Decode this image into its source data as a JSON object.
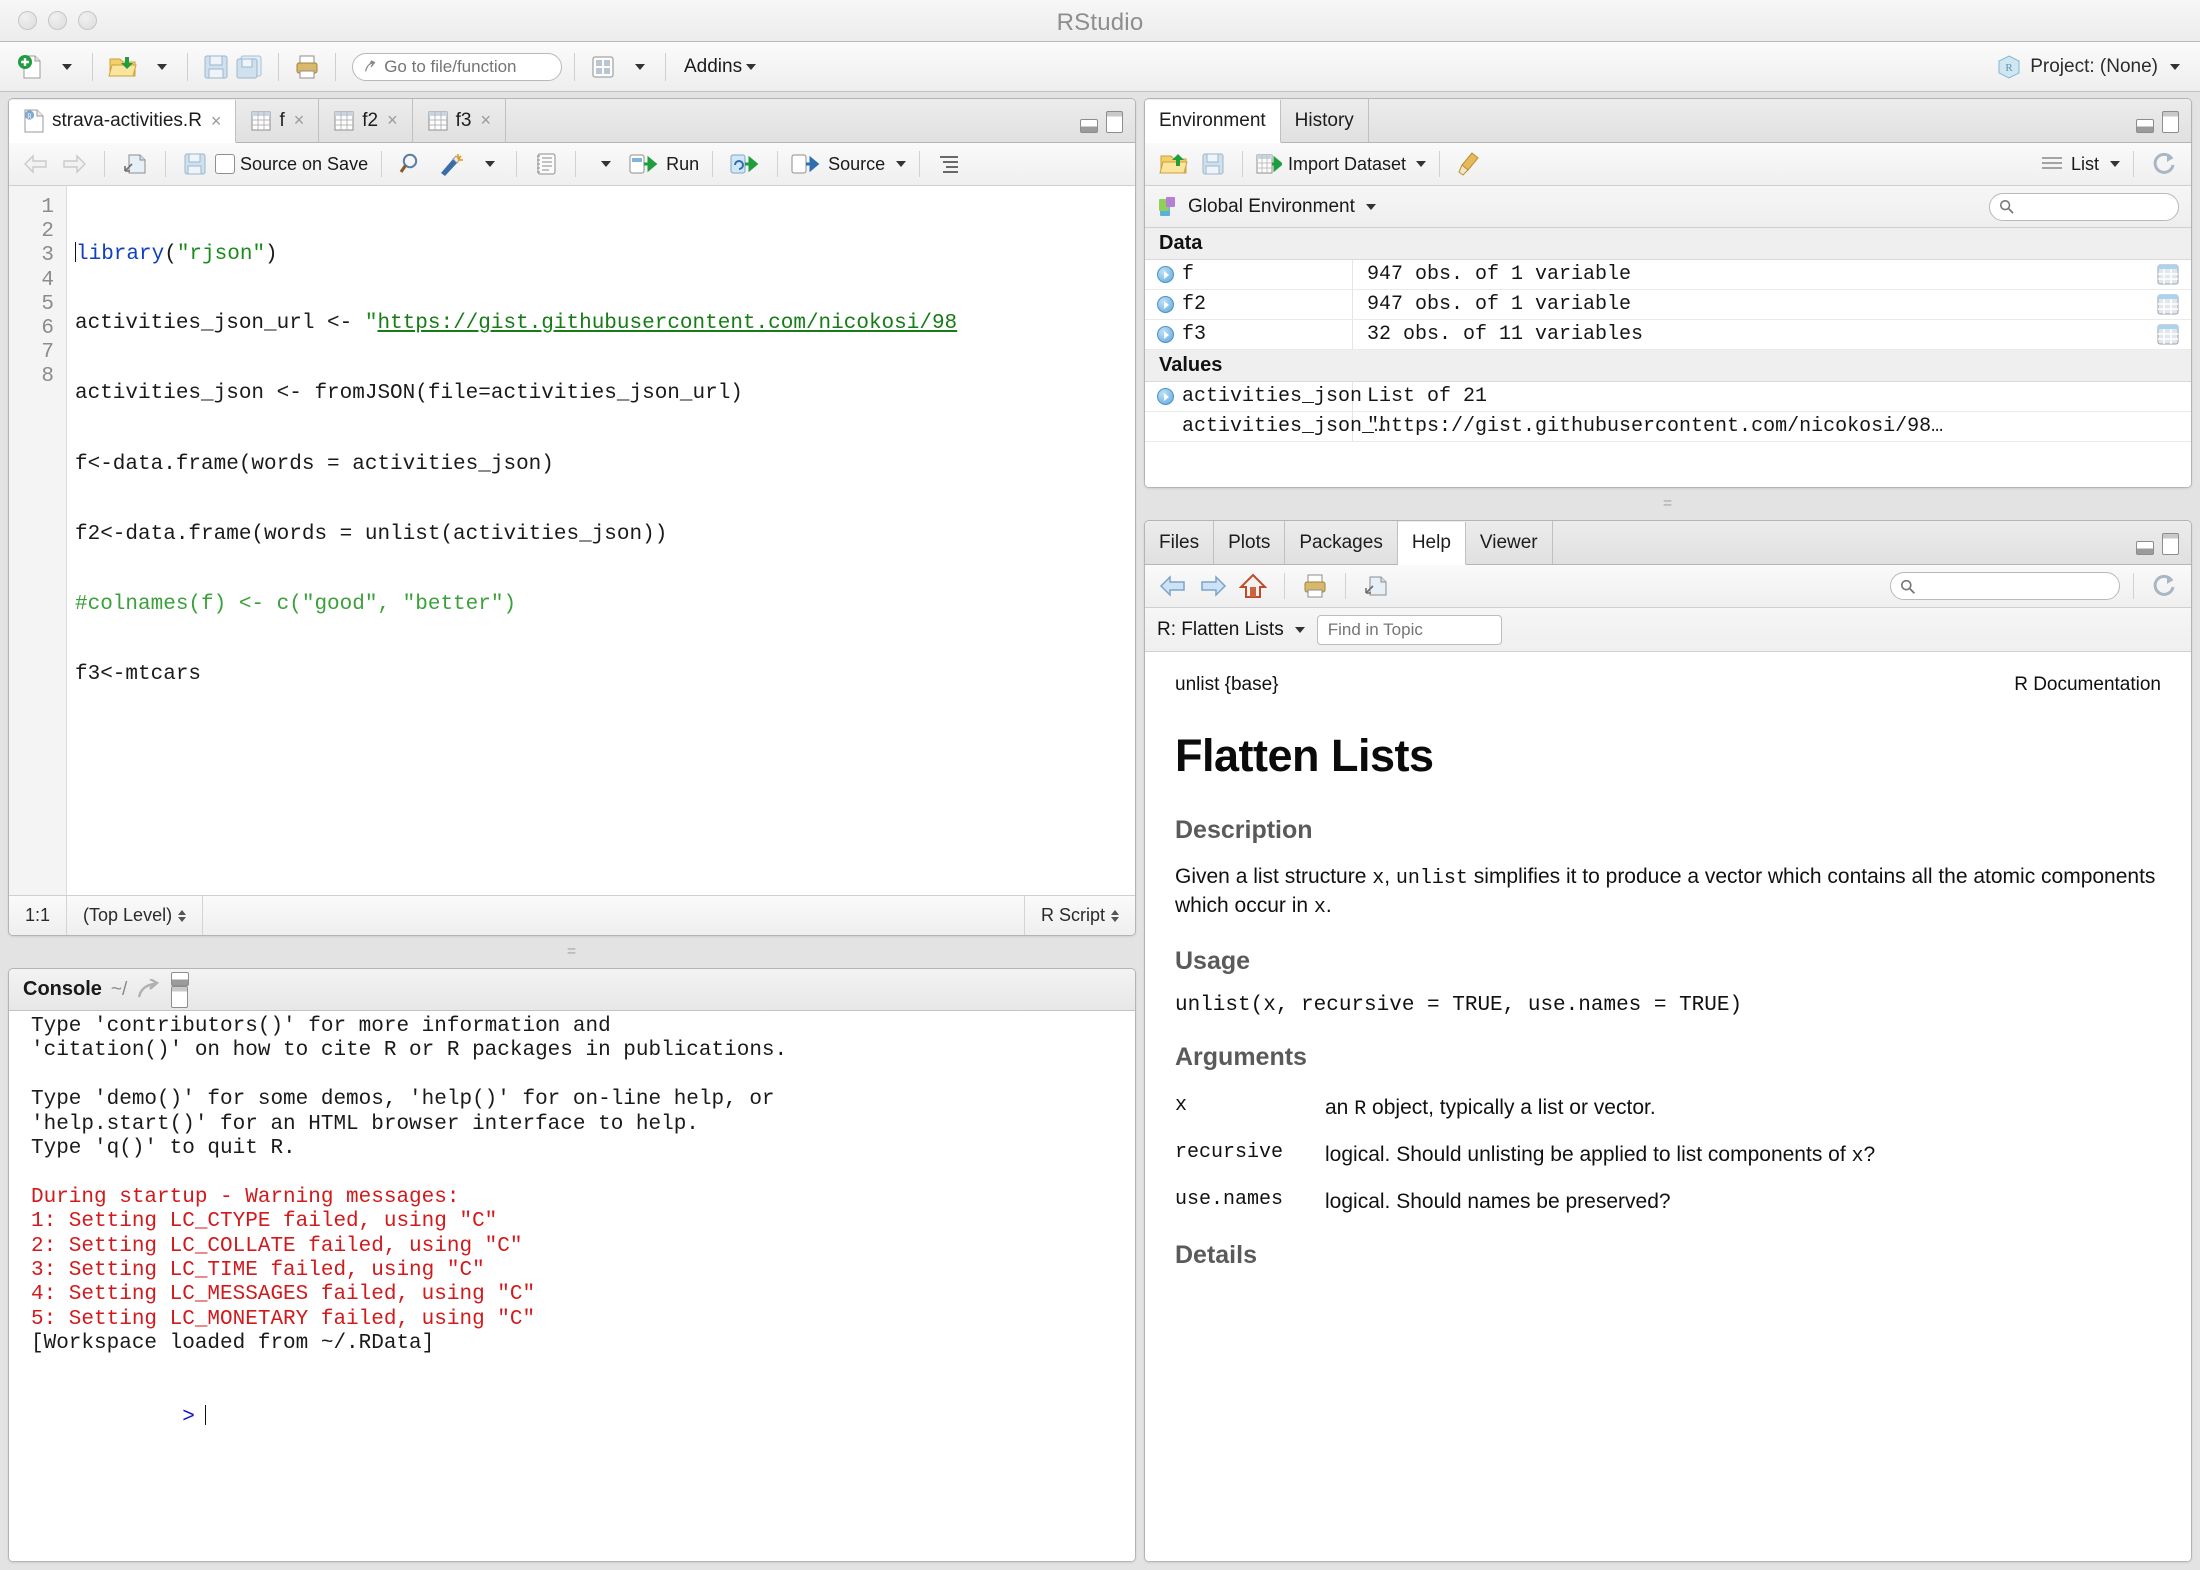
{
  "window": {
    "title": "RStudio"
  },
  "toolbar": {
    "new_file": "new-file",
    "open_file": "open-file",
    "save": "save",
    "save_all": "save-all",
    "print": "print",
    "goto_placeholder": "Go to file/function",
    "goto_value": "",
    "workspace_panes": "workspace-panes",
    "addins_label": "Addins",
    "project_label": "Project: (None)"
  },
  "editor": {
    "tabs": [
      {
        "label": "strava-activities.R",
        "icon": "r-script-icon",
        "active": true
      },
      {
        "label": "f",
        "icon": "data-frame-icon",
        "active": false
      },
      {
        "label": "f2",
        "icon": "data-frame-icon",
        "active": false
      },
      {
        "label": "f3",
        "icon": "data-frame-icon",
        "active": false
      }
    ],
    "toolbar": {
      "back": "back",
      "forward": "forward",
      "popout": "show-in-new-window",
      "save": "save",
      "source_on_save": "Source on Save",
      "find": "find-replace",
      "compile_report": "compile-report",
      "code_tools": "code-tools",
      "run": "Run",
      "rerun": "re-run-previous",
      "source": "Source",
      "outline": "document-outline"
    },
    "lines": [
      {
        "n": "1",
        "segments": [
          {
            "t": "library",
            "c": "k-fn"
          },
          {
            "t": "(",
            "c": ""
          },
          {
            "t": "\"rjson\"",
            "c": "k-str"
          },
          {
            "t": ")",
            "c": ""
          }
        ]
      },
      {
        "n": "2",
        "segments": [
          {
            "t": "activities_json_url <- ",
            "c": ""
          },
          {
            "t": "\"",
            "c": "k-str"
          },
          {
            "t": "https://gist.githubusercontent.com/nicokosi/98",
            "c": "k-url"
          }
        ]
      },
      {
        "n": "3",
        "segments": [
          {
            "t": "activities_json <- fromJSON(file=activities_json_url)",
            "c": ""
          }
        ]
      },
      {
        "n": "4",
        "segments": [
          {
            "t": "f<-data.frame(words = activities_json)",
            "c": ""
          }
        ]
      },
      {
        "n": "5",
        "segments": [
          {
            "t": "f2<-data.frame(words = unlist(activities_json))",
            "c": ""
          }
        ]
      },
      {
        "n": "6",
        "segments": [
          {
            "t": "#colnames(f) <- c(\"good\", \"better\")",
            "c": "k-cmt"
          }
        ]
      },
      {
        "n": "7",
        "segments": [
          {
            "t": "f3<-mtcars",
            "c": ""
          }
        ]
      },
      {
        "n": "8",
        "segments": [
          {
            "t": "",
            "c": ""
          }
        ]
      }
    ],
    "status": {
      "cursor": "1:1",
      "scope": "(Top Level)",
      "filetype": "R Script"
    }
  },
  "console": {
    "title": "Console",
    "path": "~/",
    "lines": [
      {
        "text": "Type 'contributors()' for more information and",
        "cls": ""
      },
      {
        "text": "'citation()' on how to cite R or R packages in publications.",
        "cls": ""
      },
      {
        "text": "",
        "cls": ""
      },
      {
        "text": "Type 'demo()' for some demos, 'help()' for on-line help, or",
        "cls": ""
      },
      {
        "text": "'help.start()' for an HTML browser interface to help.",
        "cls": ""
      },
      {
        "text": "Type 'q()' to quit R.",
        "cls": ""
      },
      {
        "text": "",
        "cls": ""
      },
      {
        "text": "During startup - Warning messages:",
        "cls": "err"
      },
      {
        "text": "1: Setting LC_CTYPE failed, using \"C\"",
        "cls": "err"
      },
      {
        "text": "2: Setting LC_COLLATE failed, using \"C\"",
        "cls": "err"
      },
      {
        "text": "3: Setting LC_TIME failed, using \"C\"",
        "cls": "err"
      },
      {
        "text": "4: Setting LC_MESSAGES failed, using \"C\"",
        "cls": "err"
      },
      {
        "text": "5: Setting LC_MONETARY failed, using \"C\"",
        "cls": "err"
      },
      {
        "text": "[Workspace loaded from ~/.RData]",
        "cls": ""
      },
      {
        "text": "",
        "cls": ""
      }
    ],
    "prompt": ">"
  },
  "environment": {
    "tabs": [
      {
        "label": "Environment",
        "active": true
      },
      {
        "label": "History",
        "active": false
      }
    ],
    "toolbar": {
      "load": "load-workspace",
      "save": "save-workspace",
      "import_dataset": "Import Dataset",
      "clear": "clear-objects",
      "view_mode": "List",
      "refresh": "refresh"
    },
    "scope": "Global Environment",
    "search_placeholder": "",
    "search_value": "",
    "groups": [
      {
        "name": "Data",
        "rows": [
          {
            "name": "f",
            "value": "947 obs. of 1 variable",
            "expandable": true,
            "grid": true
          },
          {
            "name": "f2",
            "value": "947 obs. of 1 variable",
            "expandable": true,
            "grid": true
          },
          {
            "name": "f3",
            "value": "32 obs. of 11 variables",
            "expandable": true,
            "grid": true
          }
        ]
      },
      {
        "name": "Values",
        "rows": [
          {
            "name": "activities_json",
            "value": "List of 21",
            "expandable": true,
            "grid": false
          },
          {
            "name": "activities_json_…",
            "value": "\"https://gist.githubusercontent.com/nicokosi/98…",
            "expandable": false,
            "grid": false
          }
        ]
      }
    ]
  },
  "help": {
    "tabs": [
      {
        "label": "Files",
        "active": false
      },
      {
        "label": "Plots",
        "active": false
      },
      {
        "label": "Packages",
        "active": false
      },
      {
        "label": "Help",
        "active": true
      },
      {
        "label": "Viewer",
        "active": false
      }
    ],
    "toolbar": {
      "back": "back",
      "forward": "forward",
      "home": "home",
      "print": "print",
      "popout": "show-in-new-window",
      "search_placeholder": "",
      "search_value": "",
      "refresh": "refresh"
    },
    "topic_selector": "R: Flatten Lists",
    "find_placeholder": "Find in Topic",
    "find_value": "",
    "doc": {
      "meta_left": "unlist {base}",
      "meta_right": "R Documentation",
      "title": "Flatten Lists",
      "sections": {
        "description_heading": "Description",
        "description_pre": "Given a list structure ",
        "description_code1": "x",
        "description_mid1": ", ",
        "description_code2": "unlist",
        "description_mid2": " simplifies it to produce a vector which contains all the atomic components which occur in ",
        "description_code3": "x",
        "description_end": ".",
        "usage_heading": "Usage",
        "usage_code": "unlist(x, recursive = TRUE, use.names = TRUE)",
        "arguments_heading": "Arguments",
        "details_heading": "Details"
      },
      "arguments": [
        {
          "name": "x",
          "desc_pre": "an ",
          "desc_code": "R",
          "desc_post": " object, typically a list or vector."
        },
        {
          "name": "recursive",
          "desc_pre": "logical. Should unlisting be applied to list components of ",
          "desc_code": "x",
          "desc_post": "?"
        },
        {
          "name": "use.names",
          "desc_pre": "logical. Should names be preserved?",
          "desc_code": "",
          "desc_post": ""
        }
      ]
    }
  },
  "colors": {
    "accent_blue": "#1212cc",
    "error_red": "#d2191b",
    "string_green": "#1a8a1a",
    "comment_green": "#3aa13a",
    "function_blue": "#1040c0"
  }
}
